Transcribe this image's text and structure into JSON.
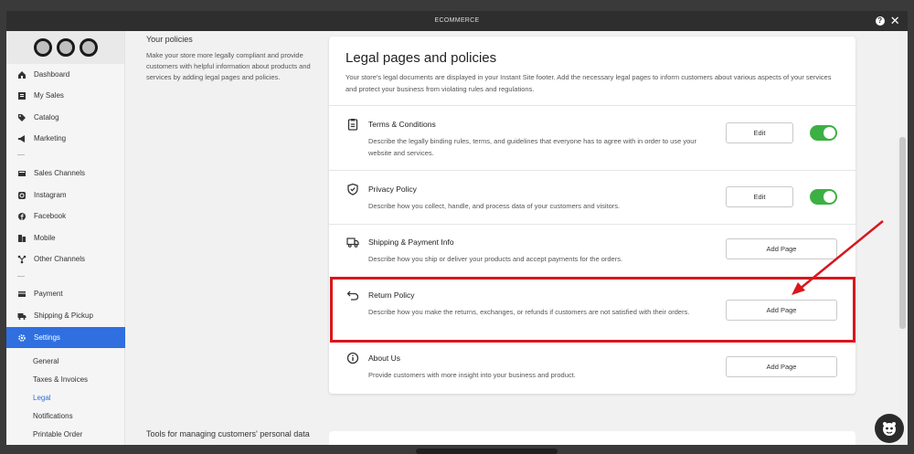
{
  "window": {
    "title": "ECOMMERCE"
  },
  "sidebar": {
    "items": [
      {
        "label": "Dashboard",
        "icon": "home-icon"
      },
      {
        "label": "My Sales",
        "icon": "sales-icon"
      },
      {
        "label": "Catalog",
        "icon": "tag-icon"
      },
      {
        "label": "Marketing",
        "icon": "megaphone-icon"
      },
      {
        "label": "Sales Channels",
        "icon": "channels-icon"
      },
      {
        "label": "Instagram",
        "icon": "instagram-icon"
      },
      {
        "label": "Facebook",
        "icon": "facebook-icon"
      },
      {
        "label": "Mobile",
        "icon": "mobile-icon"
      },
      {
        "label": "Other Channels",
        "icon": "share-icon"
      },
      {
        "label": "Payment",
        "icon": "card-icon"
      },
      {
        "label": "Shipping & Pickup",
        "icon": "truck-icon"
      },
      {
        "label": "Settings",
        "icon": "gear-icon"
      }
    ],
    "settings_sub": [
      "General",
      "Taxes & Invoices",
      "Legal",
      "Notifications",
      "Printable Order"
    ]
  },
  "left_column": {
    "heading": "Your policies",
    "text": "Make your store more legally compliant and provide customers with helpful information about products and services by adding legal pages and policies."
  },
  "tools_heading": "Tools for managing customers' personal data",
  "card": {
    "title": "Legal pages and policies",
    "intro": "Your store's legal documents are displayed in your Instant Site footer. Add the necessary legal pages to inform customers about various aspects of your services and protect your business from violating rules and regulations.",
    "policies": [
      {
        "title": "Terms & Conditions",
        "desc": "Describe the legally binding rules, terms, and guidelines that everyone has to agree with in order to use your website and services.",
        "button": "Edit",
        "enabled": true,
        "icon": "document-icon"
      },
      {
        "title": "Privacy Policy",
        "desc": "Describe how you collect, handle, and process data of your customers and visitors.",
        "button": "Edit",
        "enabled": true,
        "icon": "shield-icon"
      },
      {
        "title": "Shipping & Payment Info",
        "desc": "Describe how you ship or deliver your products and accept payments for the orders.",
        "button": "Add Page",
        "enabled": false,
        "icon": "truck-icon"
      },
      {
        "title": "Return Policy",
        "desc": "Describe how you make the returns, exchanges, or refunds if customers are not satisfied with their orders.",
        "button": "Add Page",
        "enabled": false,
        "icon": "return-arrow-icon"
      },
      {
        "title": "About Us",
        "desc": "Provide customers with more insight into your business and product.",
        "button": "Add Page",
        "enabled": false,
        "icon": "info-icon"
      }
    ]
  },
  "colors": {
    "accent": "#2f6fe0",
    "toggle_on": "#3cb043",
    "annotation": "#d9161c"
  }
}
